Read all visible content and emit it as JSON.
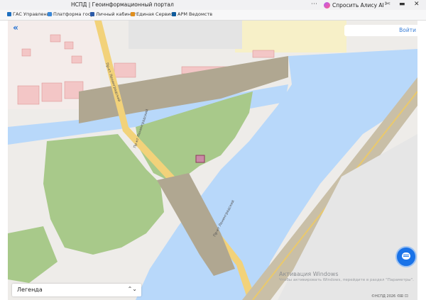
{
  "window": {
    "title": "НСПД | Геоинформационный портал",
    "more_glyph": "⋯"
  },
  "assistant": {
    "label": "Спросить Алису AI"
  },
  "controls": {
    "puzzle": "✄",
    "minimize": "▬",
    "close": "✕"
  },
  "bookmarks": [
    {
      "label": "ГАС Управление",
      "icon": "building-icon",
      "color": "#1e6fbf"
    },
    {
      "label": "Платформа госу",
      "icon": "shield-icon",
      "color": "#3a88d8"
    },
    {
      "label": "Личный кабинет",
      "icon": "cabinet-icon",
      "color": "#2b5aa8"
    },
    {
      "label": "Единая Сервисн",
      "icon": "service-icon",
      "color": "#e08f1e"
    },
    {
      "label": "АРМ Ведомств",
      "icon": "arm-icon",
      "color": "#0f5b9c"
    }
  ],
  "map": {
    "login_label": "Войти",
    "collapse_glyph": "«",
    "colors": {
      "water": "#b8d8fa",
      "grass": "#a8c98a",
      "bridge": "#b0a791",
      "land": "#eeece9"
    },
    "labels": [
      "Пр-кт Ленинградский",
      "Пр-кт Ленинградский",
      "Пр-кт Ленинградский"
    ]
  },
  "legend": {
    "label": "Легенда",
    "chevron": "⌃⌄"
  },
  "windows_activation": {
    "title": "Активация Windows",
    "subtitle": "Чтобы активировать Windows, перейдите в раздел \"Параметры\"."
  },
  "footer": {
    "copyright": "©НСПД 2026 ©",
    "icons": "⊞ ⊡"
  },
  "chat": {
    "icon": "chat-icon"
  }
}
